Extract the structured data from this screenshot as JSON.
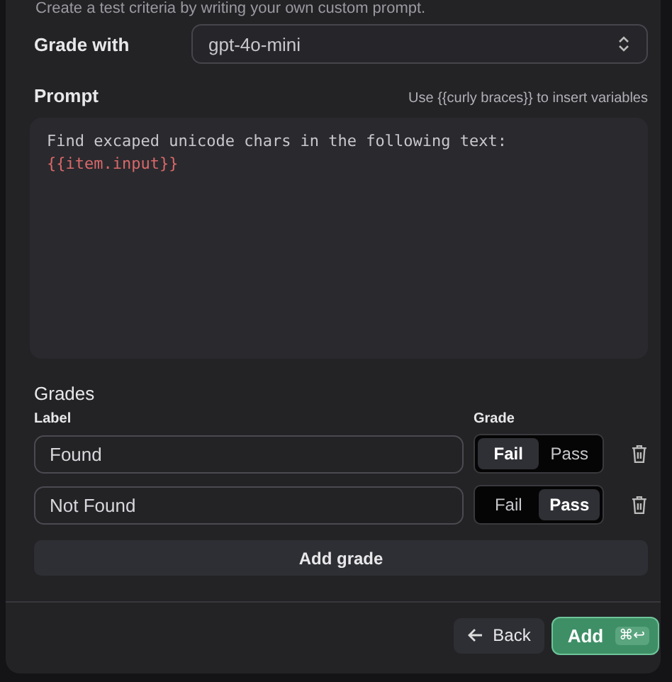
{
  "intro": "Create a test criteria by writing your own custom prompt.",
  "grade_with": {
    "label": "Grade with",
    "value": "gpt-4o-mini"
  },
  "prompt": {
    "label": "Prompt",
    "hint": "Use {{curly braces}} to insert variables",
    "lines": [
      {
        "kind": "text",
        "text": "Find excaped unicode chars in the following text:"
      },
      {
        "kind": "variable",
        "text": "{{item.input}}"
      }
    ]
  },
  "grades": {
    "title": "Grades",
    "columns": [
      "Label",
      "Grade"
    ],
    "rows": [
      {
        "label": "Found",
        "options": [
          {
            "text": "Fail",
            "selected": true
          },
          {
            "text": "Pass",
            "selected": false
          }
        ]
      },
      {
        "label": "Not Found",
        "options": [
          {
            "text": "Fail",
            "selected": false
          },
          {
            "text": "Pass",
            "selected": true
          }
        ]
      }
    ],
    "add_button": "Add grade"
  },
  "footer": {
    "back": "Back",
    "add": "Add",
    "shortcut": "⌘↩"
  }
}
